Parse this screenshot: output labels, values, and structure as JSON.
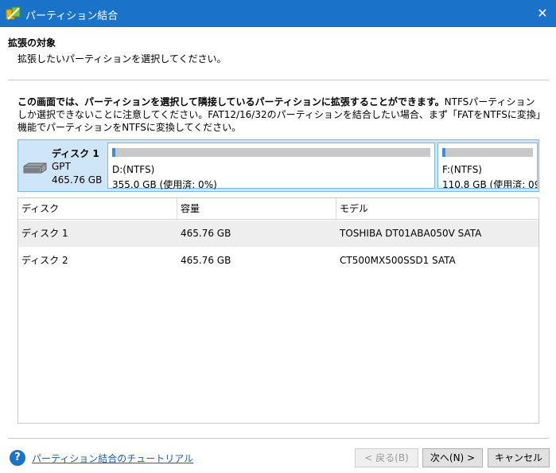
{
  "window": {
    "title": "パーティション結合"
  },
  "header": {
    "heading": "拡張の対象",
    "subheading": "拡張したいパーティションを選択してください。"
  },
  "description": {
    "bold": "この画面では、パーティションを選択して隣接しているパーティションに拡張することができます。",
    "normal": "NTFSパーティションしか選択できないことに注意してください。FAT12/16/32のパーティションを結合したい場合、まず「FATをNTFSに変換」機能でパーティションをNTFSに変換してください。"
  },
  "disk_map": {
    "name": "ディスク 1",
    "type": "GPT",
    "size": "465.76 GB",
    "partitions": [
      {
        "label": "D:(NTFS)",
        "usage": "355.0 GB (使用済: 0%)",
        "used_fraction": 0.0
      },
      {
        "label": "F:(NTFS)",
        "usage": "110.8 GB (使用済: 09",
        "used_fraction": 0.0
      }
    ]
  },
  "table": {
    "columns": [
      "ディスク",
      "容量",
      "モデル"
    ],
    "rows": [
      {
        "disk": "ディスク 1",
        "capacity": "465.76 GB",
        "model": "TOSHIBA DT01ABA050V SATA"
      },
      {
        "disk": "ディスク 2",
        "capacity": "465.76 GB",
        "model": "CT500MX500SSD1 SATA"
      }
    ]
  },
  "footer": {
    "help_link": "パーティション結合のチュートリアル",
    "back": "< 戻る(B)",
    "next": "次へ(N) >",
    "cancel": "キャンセル"
  },
  "colors": {
    "titlebar": "#1a73c9",
    "selection": "#cfe6f8",
    "usage_fill": "#3c8fd6"
  }
}
